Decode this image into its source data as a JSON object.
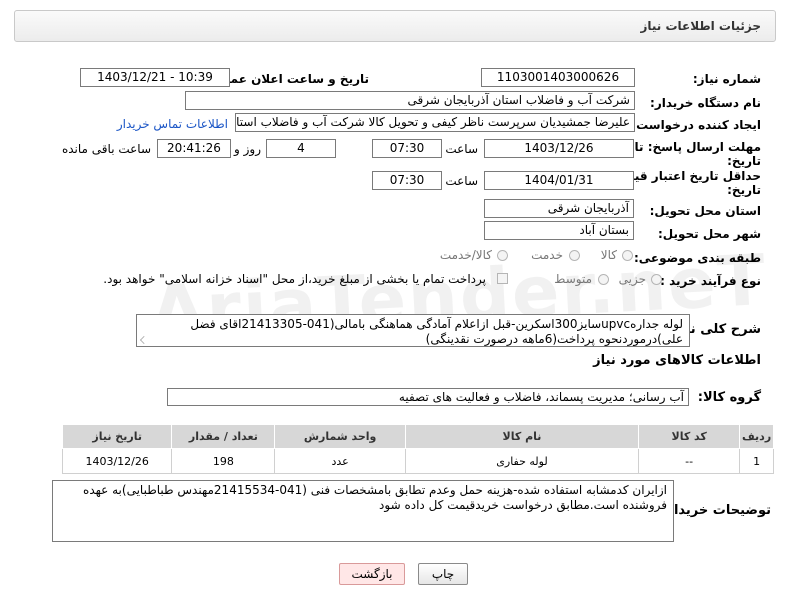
{
  "panel": {
    "title": "جزئیات اطلاعات نیاز"
  },
  "fields": {
    "need_number": {
      "label": "شماره نیاز:",
      "value": "1103001403000626"
    },
    "announce_datetime": {
      "label": "تاریخ و ساعت اعلان عمومی:",
      "value": "1403/12/21 - 10:39"
    },
    "buyer_org": {
      "label": "نام دستگاه خریدار:",
      "value": "شرکت آب و فاضلاب استان آذربایجان شرقی"
    },
    "requester": {
      "label": "ایجاد کننده درخواست:",
      "value": "علیرضا جمشیدیان سرپرست ناظر کیفی و تحویل کالا شرکت آب و فاضلاب استان",
      "contact_link": "اطلاعات تماس خریدار"
    },
    "reply_deadline": {
      "label_line1": "مهلت ارسال پاسخ: تا",
      "label_line2": "تاریخ:",
      "date": "1403/12/26",
      "time_label": "ساعت",
      "time": "07:30",
      "days": "4",
      "days_label": "روز و",
      "remaining": "20:41:26",
      "remaining_label": "ساعت باقی مانده"
    },
    "price_validity": {
      "label_line1": "حداقل تاریخ اعتبار قیمت: تا",
      "label_line2": "تاریخ:",
      "date": "1404/01/31",
      "time_label": "ساعت",
      "time": "07:30"
    },
    "delivery_province": {
      "label": "استان محل تحویل:",
      "value": "آذربایجان شرقی"
    },
    "delivery_city": {
      "label": "شهر محل تحویل:",
      "value": "بستان آباد"
    },
    "category": {
      "label": "طبقه بندی موضوعی:",
      "options": [
        "کالا",
        "خدمت",
        "کالا/خدمت"
      ]
    },
    "purchase_type": {
      "label": "نوع فرآیند خرید :",
      "options": [
        "جزیی",
        "متوسط"
      ],
      "note": "پرداخت تمام یا بخشی از مبلغ خرید،از محل \"اسناد خزانه اسلامی\" خواهد بود."
    },
    "description": {
      "label": "شرح کلی نیاز:",
      "value": "لوله جدارهupvcسایز300اسکرین-قبل ازاعلام آمادگی هماهنگی بامالی(041-21413305اقای فضل علی)درموردنحوه پرداخت(6ماهه درصورت نقدینگی)"
    }
  },
  "items_section": {
    "title": "اطلاعات کالاهای مورد نیاز",
    "group_label": "گروه کالا:",
    "group_value": "آب رسانی؛ مدیریت پسماند، فاضلاب و فعالیت های تصفیه",
    "columns": [
      "ردیف",
      "کد کالا",
      "نام کالا",
      "واحد شمارش",
      "تعداد / مقدار",
      "تاریخ نیاز"
    ],
    "rows": [
      {
        "row": "1",
        "code": "--",
        "name": "لوله حفاری",
        "unit": "عدد",
        "qty": "198",
        "date": "1403/12/26"
      }
    ]
  },
  "buyer_notes": {
    "label": "توضیحات خریدار:",
    "value": "ازایران کدمشابه استفاده شده-هزینه حمل وعدم تطابق بامشخصات فنی (041-21415534مهندس طباطبایی)به عهده فروشنده است.مطابق درخواست خریدقیمت کل داده شود"
  },
  "buttons": {
    "print": "چاپ",
    "back": "بازگشت"
  },
  "watermark": "AriaTender.neT"
}
